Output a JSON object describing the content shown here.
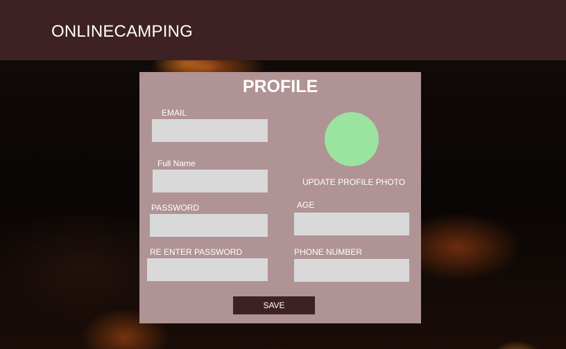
{
  "header": {
    "brand": "ONLINECAMPING"
  },
  "profile": {
    "title": "PROFILE",
    "fields": {
      "email": {
        "label": "EMAIL",
        "value": ""
      },
      "full_name": {
        "label": "Full Name",
        "value": ""
      },
      "password": {
        "label": "PASSWORD",
        "value": ""
      },
      "re_enter_password": {
        "label": "RE ENTER PASSWORD",
        "value": ""
      },
      "age": {
        "label": "AGE",
        "value": ""
      },
      "phone_number": {
        "label": "PHONE NUMBER",
        "value": ""
      }
    },
    "update_photo_label": "UPDATE PROFILE PHOTO",
    "save_label": "SAVE"
  },
  "colors": {
    "header_bg": "#3e2223",
    "panel_bg": "#b09394",
    "input_bg": "#d9d9d9",
    "avatar": "#9be4a0",
    "button_bg": "#3e2223"
  }
}
